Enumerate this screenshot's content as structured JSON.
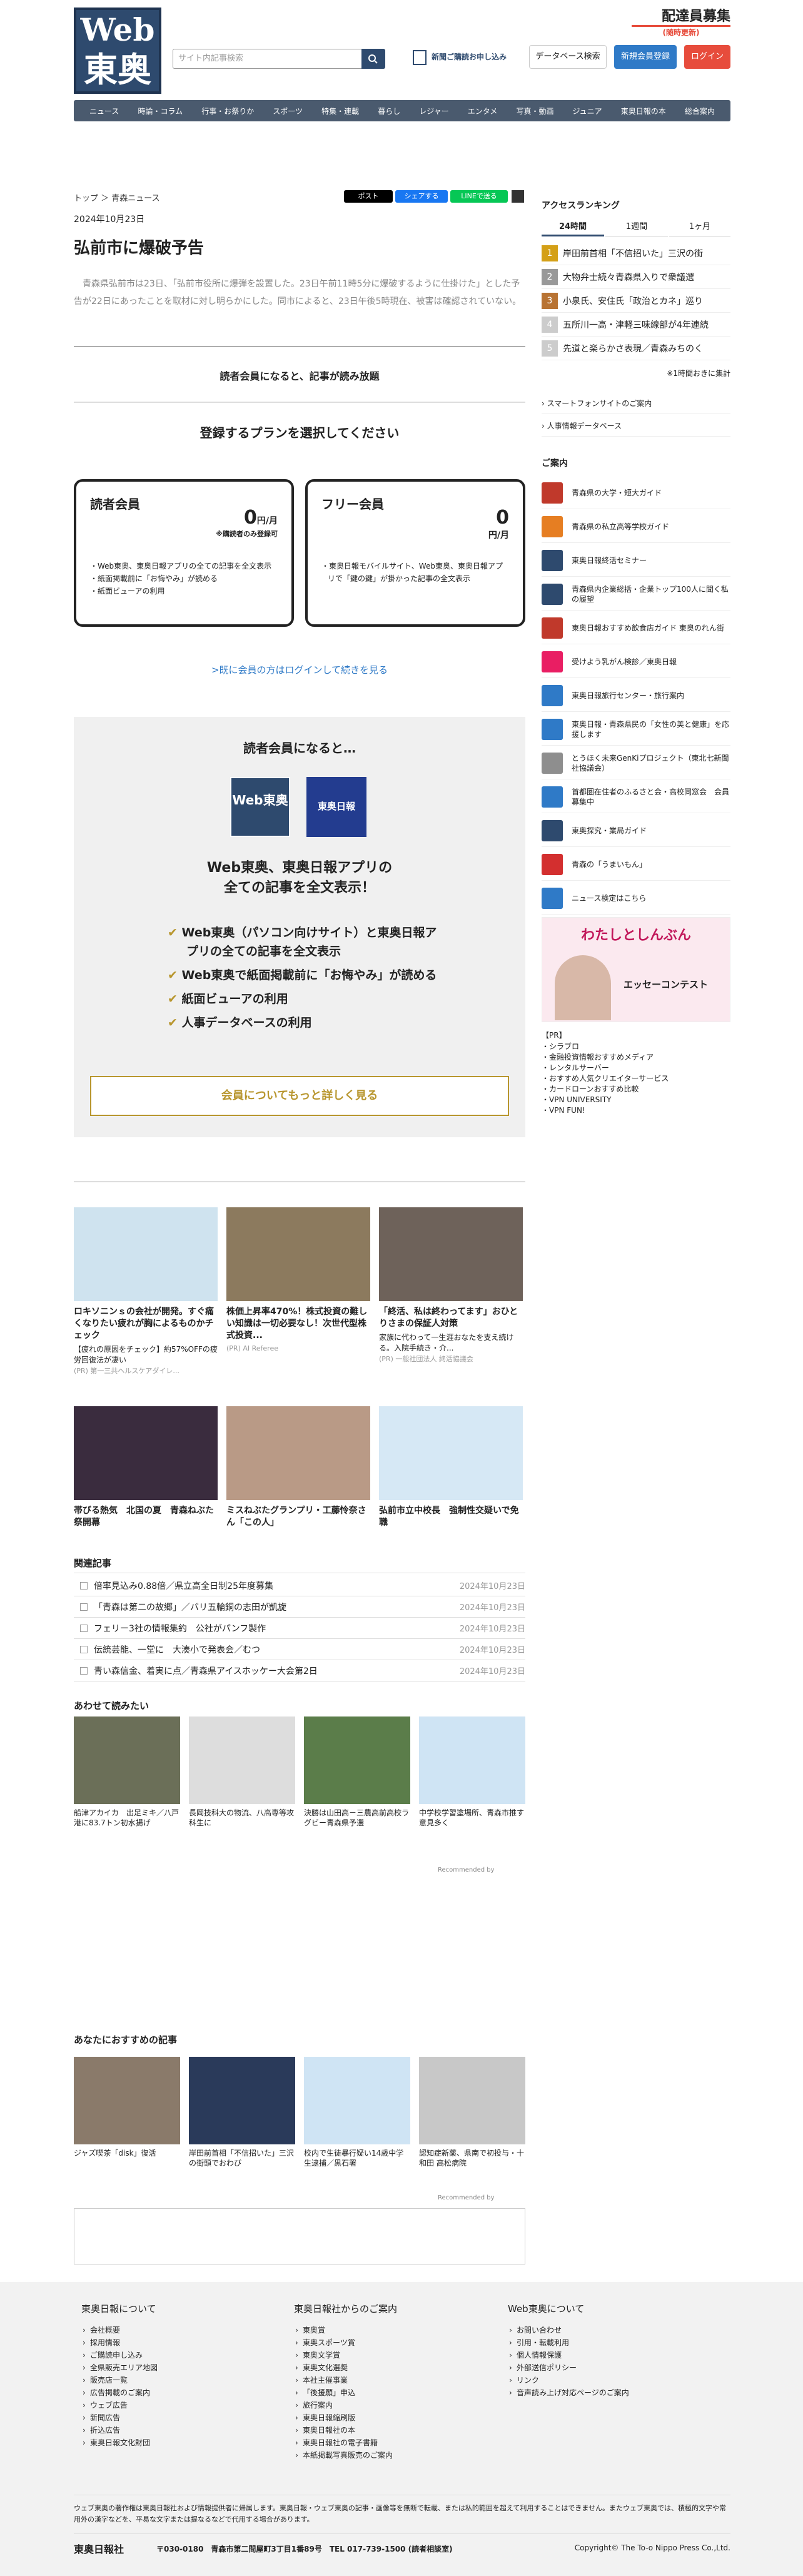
{
  "header": {
    "logo_top": "Web",
    "logo_bottom": "東奥",
    "search_placeholder": "サイト内記事検索",
    "subscribe": "新聞ご購読お申し込み",
    "database": "データベース検索",
    "register": "新規会員登録",
    "login": "ログイン",
    "recruit_title": "配達員募集",
    "recruit_sub": "(随時更新)"
  },
  "nav": [
    "ニュース",
    "時論・コラム",
    "行事・お祭りか",
    "スポーツ",
    "特集・連載",
    "暮らし",
    "レジャー",
    "エンタメ",
    "写真・動画",
    "ジュニア",
    "東奥日報の本",
    "総合案内"
  ],
  "article": {
    "breadcrumb": "トップ ＞ 青森ニュース",
    "share": [
      "ポスト",
      "シェアする",
      "LINEで送る"
    ],
    "date": "2024年10月23日",
    "title": "弘前市に爆破予告",
    "lead": "　青森県弘前市は23日、「弘前市役所に爆弾を設置した。23日午前11時5分に爆破するように仕掛けた」とした予告が22日にあったことを取材に対し明らかにした。同市によると、23日午後5時現在、被害は確認されていない。",
    "member_notice": "読者会員になると、記事が読み放題",
    "select_plan": "登録するプランを選択してください"
  },
  "plans": [
    {
      "name": "読者会員",
      "price": "0",
      "unit": "円/月",
      "note": "※購読者のみ登録可",
      "items": [
        "Web東奥、東奥日報アプリの全ての記事を全文表示",
        "紙面掲載前に「お悔やみ」が読める",
        "紙面ビューアの利用"
      ]
    },
    {
      "name": "フリー会員",
      "price": "0",
      "unit": "円/月",
      "note": "",
      "items": [
        "東奥日報モバイルサイト、Web東奥、東奥日報アプリで「鍵の鍵」が掛かった記事の全文表示"
      ]
    }
  ],
  "login_link": ">既に会員の方はログインして続きを見る",
  "benefits": {
    "title": "読者会員になると…",
    "logo1": "Web東奥",
    "logo2": "東奥日報",
    "headline1": "Web東奥、東奥日報アプリの",
    "headline2": "全ての記事を全文表示！",
    "items": [
      "Web東奥（パソコン向けサイト）と東奥日報アプリの全ての記事を全文表示",
      "Web東奥で紙面掲載前に「お悔やみ」が読める",
      "紙面ビューアの利用",
      "人事データベースの利用"
    ],
    "button": "会員についてもっと詳しく見る"
  },
  "cards": [
    {
      "title": "ロキソニンｓの会社が開発。すぐ痛くなりたい疲れが胸によるものかチェック",
      "sub": "【疲れの原因をチェック】約57%OFFの疲労回復法が凄い",
      "src": "(PR) 第一三共ヘルスケアダイレ..."
    },
    {
      "title": "株価上昇率470%！株式投資の難しい知識は一切必要なし！次世代型株式投資...",
      "sub": "",
      "src": "(PR) AI Referee"
    },
    {
      "title": "「終活、私は終わってます」おひとりさまの保証人対策",
      "sub": "家族に代わって一生涯おなたを支え続ける。入院手続き・介...",
      "src": "(PR) 一般社団法人 終活協議会"
    },
    {
      "title": "帯びる熱気　北国の夏　青森ねぶた祭開幕",
      "sub": "",
      "src": ""
    },
    {
      "title": "ミスねぶたグランプリ・工藤怜奈さん「この人」",
      "sub": "",
      "src": ""
    },
    {
      "title": "弘前市立中校長　強制性交疑いで免職",
      "sub": "",
      "src": ""
    }
  ],
  "related": {
    "title": "関連記事",
    "items": [
      {
        "t": "倍率見込み0.88倍／県立高全日制25年度募集",
        "d": "2024年10月23日"
      },
      {
        "t": "「青森は第二の故郷」／バリ五輪銅の志田が凱旋",
        "d": "2024年10月23日"
      },
      {
        "t": "フェリー3社の情報集約　公社がパンフ製作",
        "d": "2024年10月23日"
      },
      {
        "t": "伝統芸能、一堂に　大湊小で発表会／むつ",
        "d": "2024年10月23日"
      },
      {
        "t": "青い森信金、着実に点／青森県アイスホッケー大会第2日",
        "d": "2024年10月23日"
      }
    ]
  },
  "also_read": {
    "title": "あわせて読みたい",
    "items": [
      "船津アカイカ　出足ミキ／八戸港に83.7トン初水揚げ",
      "長岡技科大の物流、八高専等攻科生に",
      "決勝は山田高－三農高前高校ラグビー青森県予選",
      "中学校学習塗場所、青森市推す意見多く"
    ],
    "credit": "Recommended by"
  },
  "recommend": {
    "title": "あなたにおすすめの記事",
    "items": [
      "ジャズ喫茶「disk」復活",
      "岸田前首相「不信招いた」三沢の街頭でおわび",
      "校内で生徒暴行疑い14歳中学生逮捕／黒石署",
      "認知症新薬、県南で初投与・十和田 高松病院"
    ],
    "credit": "Recommended by"
  },
  "ranking": {
    "title": "アクセスランキング",
    "tabs": [
      "24時間",
      "1週間",
      "1ヶ月"
    ],
    "items": [
      "岸田前首相「不信招いた」三沢の街",
      "大物弁士続々青森県入りで衆議選",
      "小泉氏、安住氏「政治とカネ」巡り",
      "五所川一高・津軽三味線部が4年連続",
      "先道と楽らかさ表現／青森みちのく"
    ],
    "note": "※1時間おきに集計",
    "links": [
      "スマートフォンサイトのご案内",
      "人事情報データベース"
    ]
  },
  "guide": {
    "title": "ご案内",
    "items": [
      "青森県の大学・短大ガイド",
      "青森県の私立高等学校ガイド",
      "東奥日報終活セミナー",
      "青森県内企業総括・企業トップ100人に聞く私の履望",
      "東奥日報おすすめ飲食店ガイド 東奥のれん街",
      "受けよう乳がん検診／東奥日報",
      "東奥日報旅行センター・旅行案内",
      "東奥日報・青森県民の「女性の美と健康」を応援します",
      "とうほく未来GenKiプロジェクト（東北七新聞社協議会）",
      "首都圏在住者のふるさと会・高校同窓会　会員募集中",
      "東奥探究・業局ガイド",
      "青森の「うまいもん」",
      "ニュース検定はこちら"
    ],
    "banner_title": "わたしとしんぶん",
    "banner_sub": "エッセーコンテスト",
    "pr_label": "【PR】",
    "pr_items": [
      "シラブロ",
      "金融投資情報おすすめメディア",
      "レンタルサーバー",
      "おすすめ人気クリエイターサービス",
      "カードローンおすすめ比較",
      "VPN UNIVERSITY",
      "VPN FUN!"
    ]
  },
  "footer": {
    "cols": [
      {
        "h": "東奥日報について",
        "items": [
          "会社概要",
          "採用情報",
          "ご購読申し込み",
          "全県販売エリア地図",
          "販売店一覧",
          "広告掲載のご案内",
          "ウェブ広告",
          "新聞広告",
          "折込広告",
          "東奥日報文化財団"
        ]
      },
      {
        "h": "東奥日報社からのご案内",
        "items": [
          "東奥賞",
          "東奥スポーツ賞",
          "東奥文学賞",
          "東奥文化選奨",
          "本社主催事業",
          "「後援願」申込",
          "旅行案内",
          "東奥日報縮刷版",
          "東奥日報社の本",
          "東奥日報社の電子書籍",
          "本紙掲載写真販売のご案内"
        ]
      },
      {
        "h": "Web東奥について",
        "items": [
          "お問い合わせ",
          "引用・転載利用",
          "個人情報保護",
          "外部送信ポリシー",
          "リンク",
          "音声読み上げ対応ページのご案内"
        ]
      }
    ],
    "notice": "ウェブ東奥の著作権は東奥日報社および情報提供者に帰属します。東奥日報・ウェブ東奥の記事・画像等を無断で転載、または私的範囲を超えて利用することはできません。またウェブ東奥では、積極的文字や常用外の漢字などを、平易な文字または提なるなどで代用する場合があります。",
    "company": "東奥日報社",
    "address": "〒030-0180　青森市第二問屋町3丁目1番89号　TEL 017-739-1500 (読者相談室)",
    "copyright": "Copyright© The To-o Nippo Press Co.,Ltd."
  },
  "colors": {
    "brand": "#2e4a6e",
    "accent": "#e74c3c",
    "gold": "#b8962e",
    "blue": "#2f7ac7"
  }
}
